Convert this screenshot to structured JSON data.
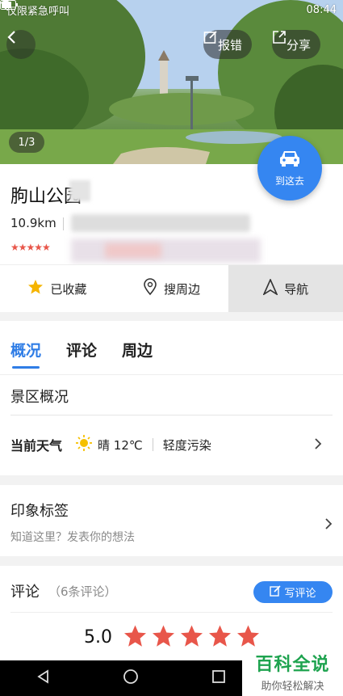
{
  "status_bar": {
    "left_text": "仅限紧急呼叫",
    "time": "08:44"
  },
  "hero": {
    "report_label": "报错",
    "share_label": "分享",
    "photo_counter": "1/3",
    "go_here_label": "到这去"
  },
  "place": {
    "name": "朐山公园",
    "distance": "10.9km",
    "rating_stars": "★★★★★"
  },
  "actions": [
    {
      "label": "已收藏",
      "icon": "star-icon"
    },
    {
      "label": "搜周边",
      "icon": "location-pin-icon"
    },
    {
      "label": "导航",
      "icon": "navigation-arrow-icon"
    }
  ],
  "tabs": [
    {
      "label": "概况",
      "active": true
    },
    {
      "label": "评论",
      "active": false
    },
    {
      "label": "周边",
      "active": false
    }
  ],
  "overview": {
    "section_title": "景区概况",
    "weather_label": "当前天气",
    "weather_text": "晴 12℃",
    "air_quality": "轻度污染"
  },
  "impression": {
    "title": "印象标签",
    "prompt": "知道这里？发表你的想法"
  },
  "comments": {
    "title": "评论",
    "count_text": "（6条评论）",
    "write_label": "写评论",
    "score": "5.0"
  },
  "watermark": {
    "brand": "百科全说",
    "slogan": "助你轻松解决"
  },
  "colors": {
    "accent": "#3586f1",
    "star": "#e8564a"
  }
}
